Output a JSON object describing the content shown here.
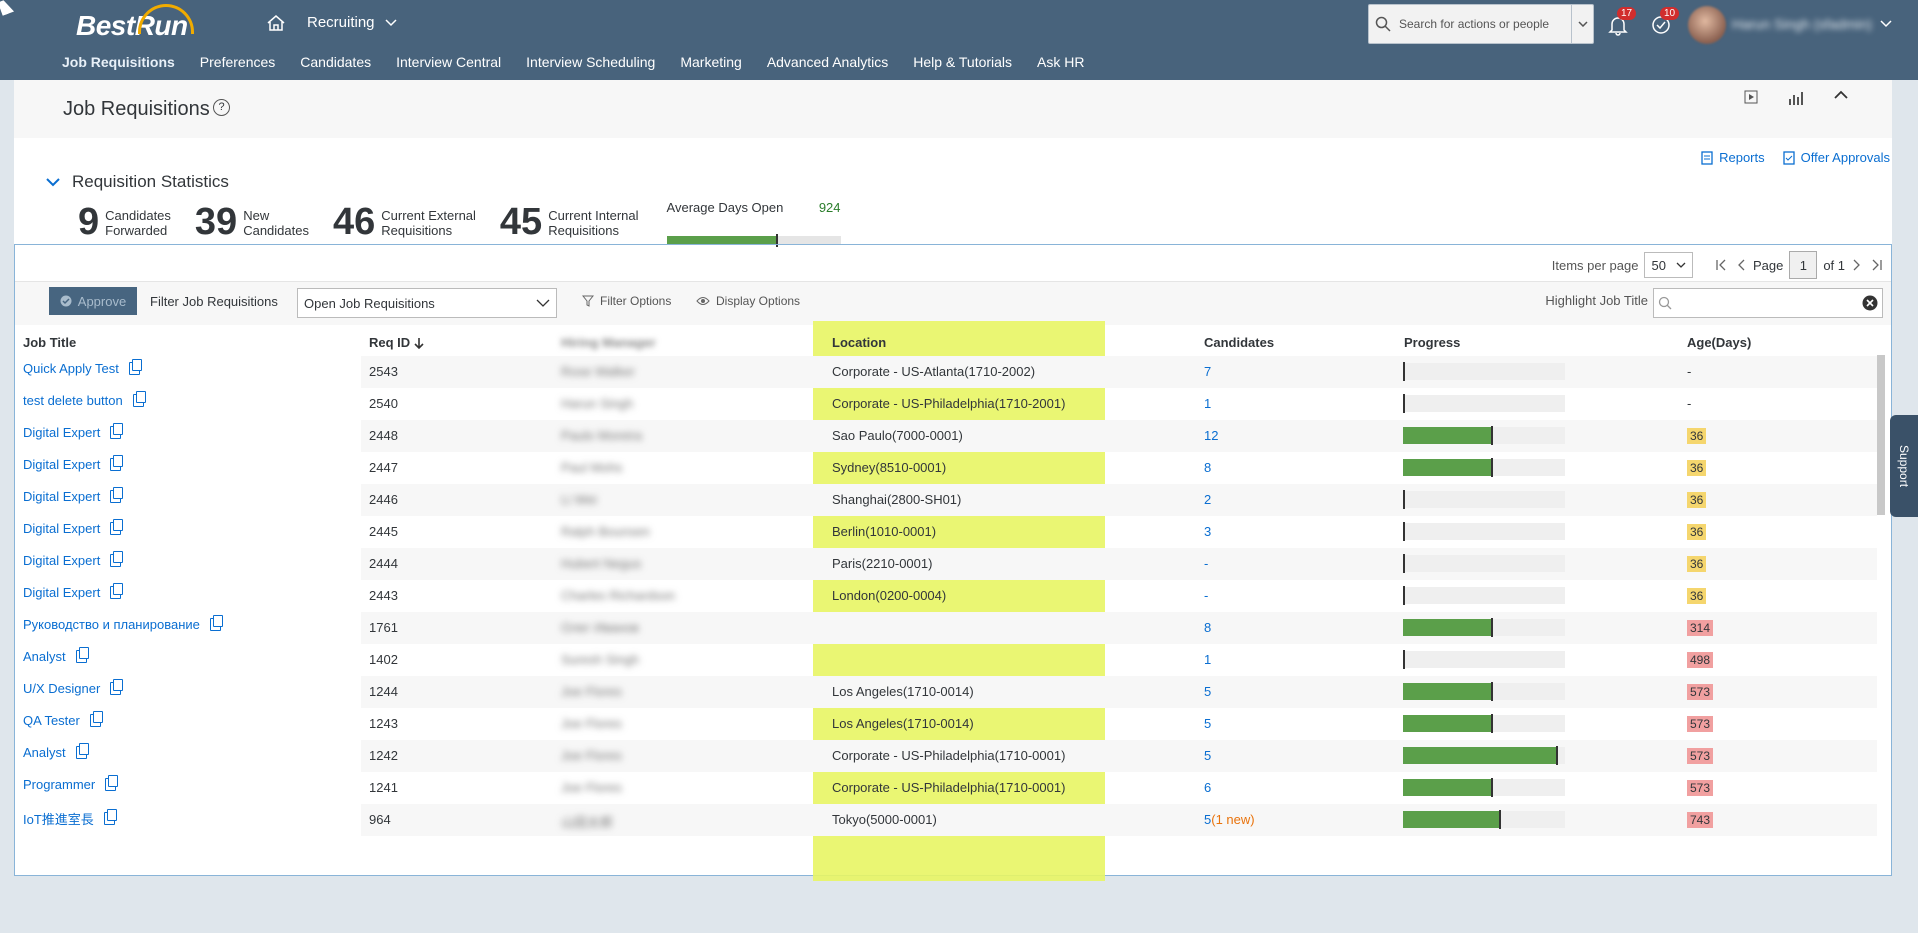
{
  "shell": {
    "brand": "BestRun",
    "module": "Recruiting",
    "search_placeholder": "Search for actions or people",
    "notifications_count": "17",
    "todo_count": "10",
    "user_name": "Harun Singh (sfadmin)",
    "nav": [
      "Job Requisitions",
      "Preferences",
      "Candidates",
      "Interview Central",
      "Interview Scheduling",
      "Marketing",
      "Advanced Analytics",
      "Help & Tutorials",
      "Ask HR"
    ]
  },
  "page": {
    "title": "Job Requisitions",
    "help": "?",
    "reports": "Reports",
    "offer_approvals": "Offer Approvals"
  },
  "stats": {
    "title": "Requisition Statistics",
    "items": [
      {
        "num": "9",
        "l1": "Candidates",
        "l2": "Forwarded"
      },
      {
        "num": "39",
        "l1": "New",
        "l2": "Candidates"
      },
      {
        "num": "46",
        "l1": "Current External",
        "l2": "Requisitions"
      },
      {
        "num": "45",
        "l1": "Current Internal",
        "l2": "Requisitions"
      }
    ],
    "avg_label": "Average Days Open",
    "avg_value": "924",
    "avg_fill_fraction": 0.63
  },
  "pager": {
    "items_per_page_label": "Items per page",
    "items_per_page": "50",
    "page_label": "Page",
    "page": "1",
    "of": "of 1"
  },
  "toolbar": {
    "approve": "Approve",
    "filter_label": "Filter Job Requisitions",
    "filter_value": "Open Job Requisitions",
    "filter_options": "Filter Options",
    "display_options": "Display Options",
    "highlight_label": "Highlight Job Title"
  },
  "columns": {
    "job_title": "Job Title",
    "req_id": "Req ID",
    "hiring_manager": "Hiring Manager",
    "location": "Location",
    "candidates": "Candidates",
    "progress": "Progress",
    "age": "Age(Days)"
  },
  "rows": [
    {
      "title": "Quick Apply Test",
      "req": "2543",
      "mgr": "Rose Walker",
      "loc": "Corporate - US-Atlanta(1710-2002)",
      "cand": "7",
      "newc": "",
      "progress": 0.0,
      "age": "-",
      "age_level": "none"
    },
    {
      "title": "test delete button",
      "req": "2540",
      "mgr": "Harun Singh",
      "loc": "Corporate - US-Philadelphia(1710-2001)",
      "cand": "1",
      "newc": "",
      "progress": 0.0,
      "age": "-",
      "age_level": "none"
    },
    {
      "title": "Digital Expert",
      "req": "2448",
      "mgr": "Paulo Moreira",
      "loc": "Sao Paulo(7000-0001)",
      "cand": "12",
      "newc": "",
      "progress": 0.55,
      "age": "36",
      "age_level": "warn"
    },
    {
      "title": "Digital Expert",
      "req": "2447",
      "mgr": "Paul Mohs",
      "loc": "Sydney(8510-0001)",
      "cand": "8",
      "newc": "",
      "progress": 0.55,
      "age": "36",
      "age_level": "warn"
    },
    {
      "title": "Digital Expert",
      "req": "2446",
      "mgr": "Li Wei",
      "loc": "Shanghai(2800-SH01)",
      "cand": "2",
      "newc": "",
      "progress": 0.0,
      "age": "36",
      "age_level": "warn"
    },
    {
      "title": "Digital Expert",
      "req": "2445",
      "mgr": "Ralph Bounsen",
      "loc": "Berlin(1010-0001)",
      "cand": "3",
      "newc": "",
      "progress": 0.0,
      "age": "36",
      "age_level": "warn"
    },
    {
      "title": "Digital Expert",
      "req": "2444",
      "mgr": "Hubert Negus",
      "loc": "Paris(2210-0001)",
      "cand": "-",
      "newc": "",
      "progress": 0.0,
      "age": "36",
      "age_level": "warn"
    },
    {
      "title": "Digital Expert",
      "req": "2443",
      "mgr": "Charles Richardson",
      "loc": "London(0200-0004)",
      "cand": "-",
      "newc": "",
      "progress": 0.0,
      "age": "36",
      "age_level": "warn"
    },
    {
      "title": "Руководство и планирование",
      "req": "1761",
      "mgr": "Олег Иванов",
      "loc": "",
      "cand": "8",
      "newc": "",
      "progress": 0.55,
      "age": "314",
      "age_level": "alert"
    },
    {
      "title": "Analyst",
      "req": "1402",
      "mgr": "Suresh Singh",
      "loc": "",
      "cand": "1",
      "newc": "",
      "progress": 0.0,
      "age": "498",
      "age_level": "alert"
    },
    {
      "title": "U/X Designer",
      "req": "1244",
      "mgr": "Joe Flores",
      "loc": "Los Angeles(1710-0014)",
      "cand": "5",
      "newc": "",
      "progress": 0.55,
      "age": "573",
      "age_level": "alert"
    },
    {
      "title": "QA Tester",
      "req": "1243",
      "mgr": "Joe Flores",
      "loc": "Los Angeles(1710-0014)",
      "cand": "5",
      "newc": "",
      "progress": 0.55,
      "age": "573",
      "age_level": "alert"
    },
    {
      "title": "Analyst",
      "req": "1242",
      "mgr": "Joe Flores",
      "loc": "Corporate - US-Philadelphia(1710-0001)",
      "cand": "5",
      "newc": "",
      "progress": 0.95,
      "age": "573",
      "age_level": "alert"
    },
    {
      "title": "Programmer",
      "req": "1241",
      "mgr": "Joe Flores",
      "loc": "Corporate - US-Philadelphia(1710-0001)",
      "cand": "6",
      "newc": "",
      "progress": 0.55,
      "age": "573",
      "age_level": "alert"
    },
    {
      "title": "IoT推進室長",
      "req": "964",
      "mgr": "山田太郎",
      "loc": "Tokyo(5000-0001)",
      "cand": "5",
      "newc": "(1 new)",
      "progress": 0.6,
      "age": "743",
      "age_level": "alert"
    }
  ],
  "support": "Support",
  "colors": {
    "shell": "#48637c",
    "link": "#0a6ed1",
    "progress": "#5b9f4a",
    "highlight": "#e8f564",
    "age_warn": "#f5d66e",
    "age_alert": "#f1a0a0"
  }
}
